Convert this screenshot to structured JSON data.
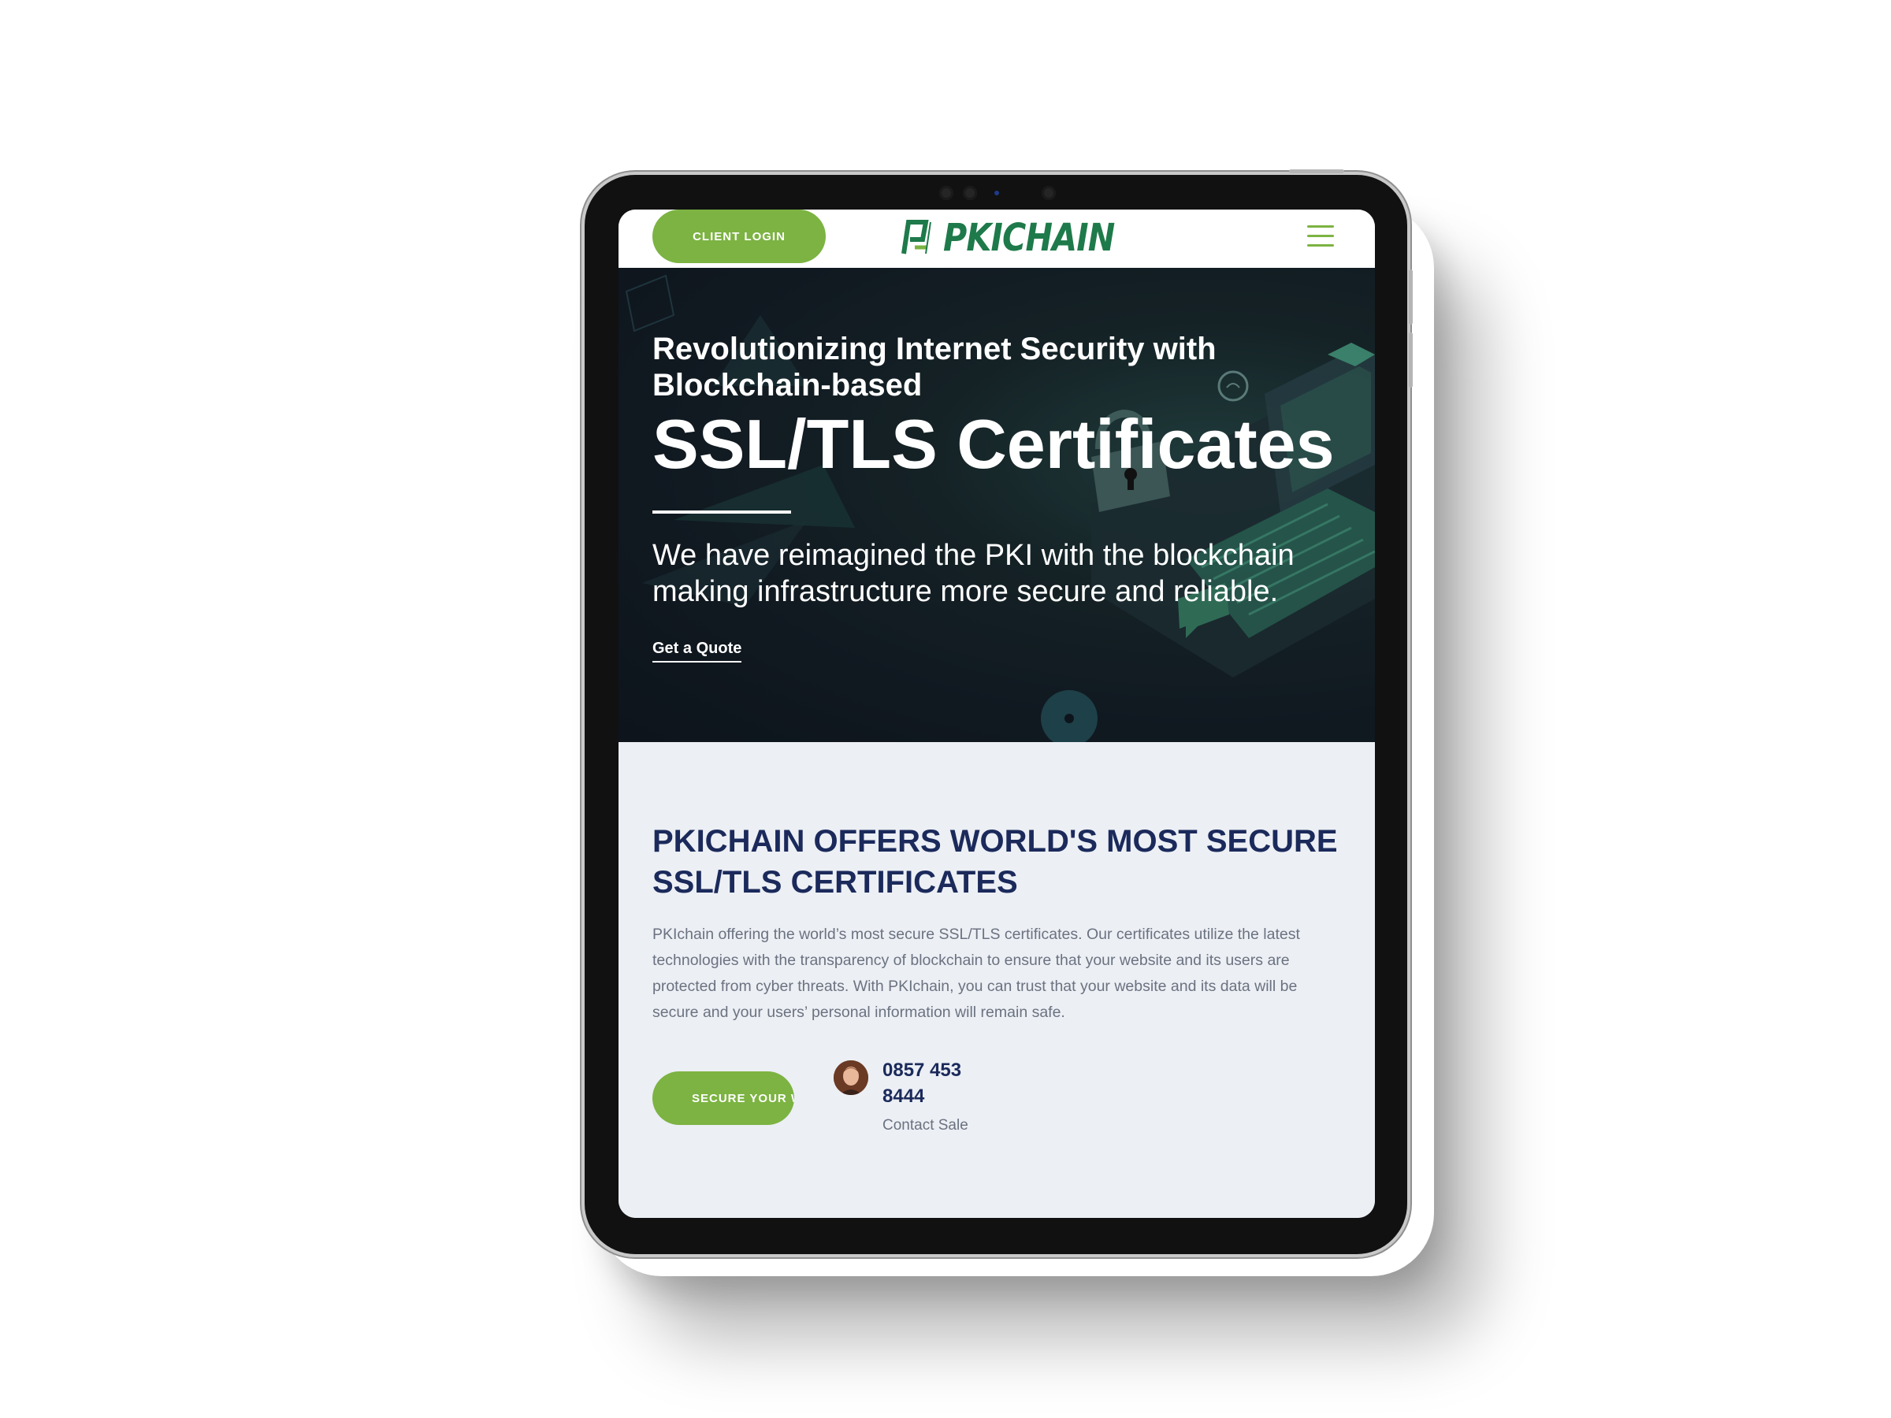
{
  "header": {
    "login_label": "CLIENT LOGIN",
    "logo_text": "PKICHAIN",
    "menu_icon": "hamburger-icon"
  },
  "hero": {
    "subtitle": "Revolutionizing Internet Security with Blockchain-based",
    "title": "SSL/TLS Certificates",
    "description": "We have reimagined the PKI with the blockchain making infrastructure more secure and reliable.",
    "cta_label": "Get a Quote"
  },
  "offer": {
    "title": "PKICHAIN OFFERS WORLD'S MOST SECURE SSL/TLS CERTIFICATES",
    "body": "PKIchain offering the world’s most secure SSL/TLS certificates. Our certificates utilize the latest technologies with the transparency of blockchain to ensure that your website and its users are protected from cyber threats. With PKIchain, you can trust that your website and its data will be secure and your users’ personal information will remain safe.",
    "button_label": "SECURE YOUR W",
    "phone": "0857 453 8444",
    "contact_label": "Contact Sale"
  },
  "colors": {
    "accent_green": "#7cb342",
    "logo_green": "#1e7a4a",
    "heading_navy": "#1b2a5b",
    "hero_bg": "#101820"
  }
}
